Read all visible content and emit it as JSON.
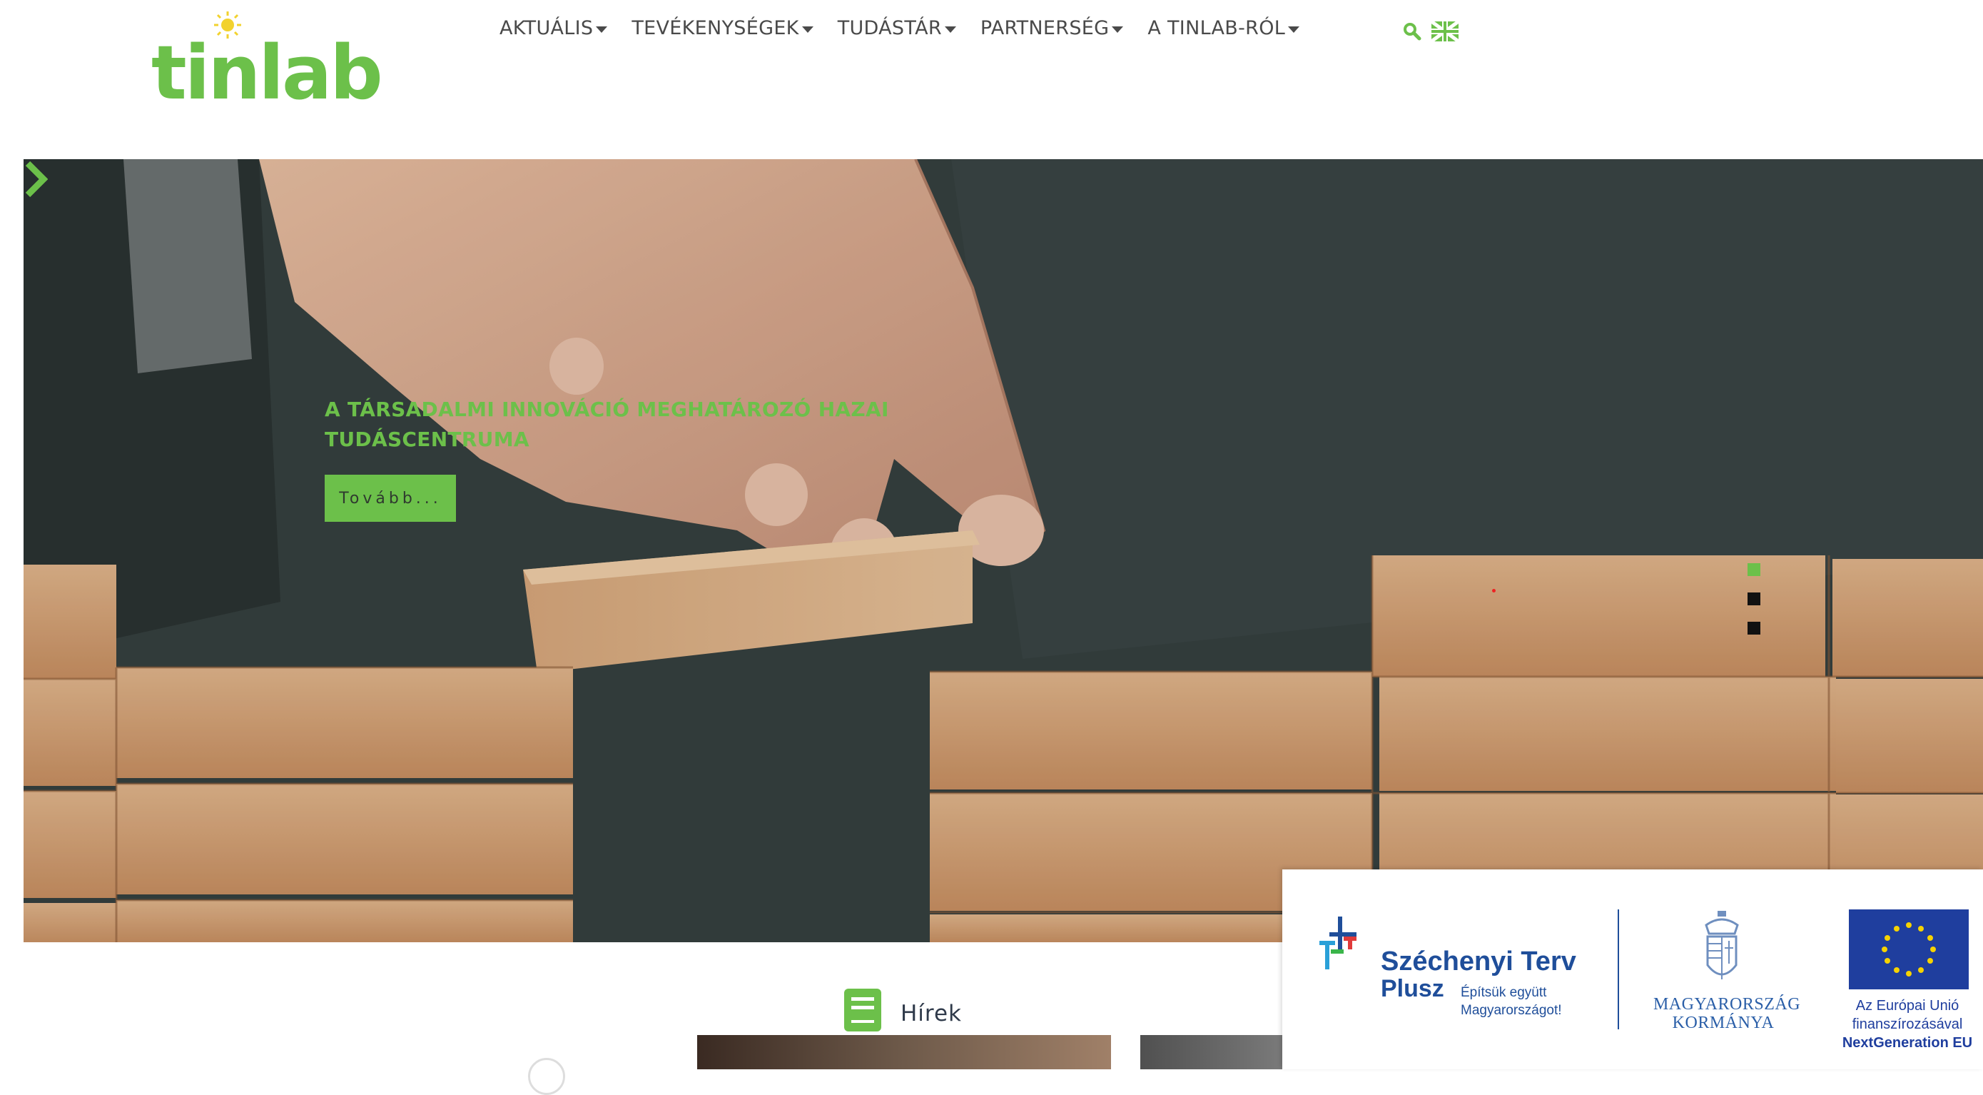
{
  "header": {
    "logo_text": "tinlab",
    "nav": [
      {
        "label": "AKTUÁLIS"
      },
      {
        "label": "TEVÉKENYSÉGEK"
      },
      {
        "label": "TUDÁSTÁR"
      },
      {
        "label": "PARTNERSÉG"
      },
      {
        "label": "A TINLAB-RÓL"
      }
    ],
    "search_icon": "search-icon",
    "language_icon": "uk-flag-icon"
  },
  "hero": {
    "title_line1": "A TÁRSADALMI INNOVÁCIÓ MEGHATÁROZÓ HAZAI",
    "title_line2": "TUDÁSCENTRUMA",
    "button_label": "Tovább...",
    "slides_count": 3,
    "active_slide": 1
  },
  "news": {
    "title": "Hírek",
    "icon": "book-icon"
  },
  "sponsor": {
    "szechenyi_name": "Széchenyi Terv",
    "szechenyi_plusz": "Plusz",
    "szechenyi_tagline_1": "Építsük együtt",
    "szechenyi_tagline_2": "Magyarországot!",
    "gov_line1": "MAGYARORSZÁG",
    "gov_line2": "KORMÁNYA",
    "eu_line1": "Az Európai Unió",
    "eu_line2": "finanszírozásával",
    "eu_line3": "NextGeneration EU"
  },
  "colors": {
    "brand_green": "#6cc04a",
    "nav_text": "#4a4a4a",
    "sponsor_blue": "#1f4e9a"
  }
}
